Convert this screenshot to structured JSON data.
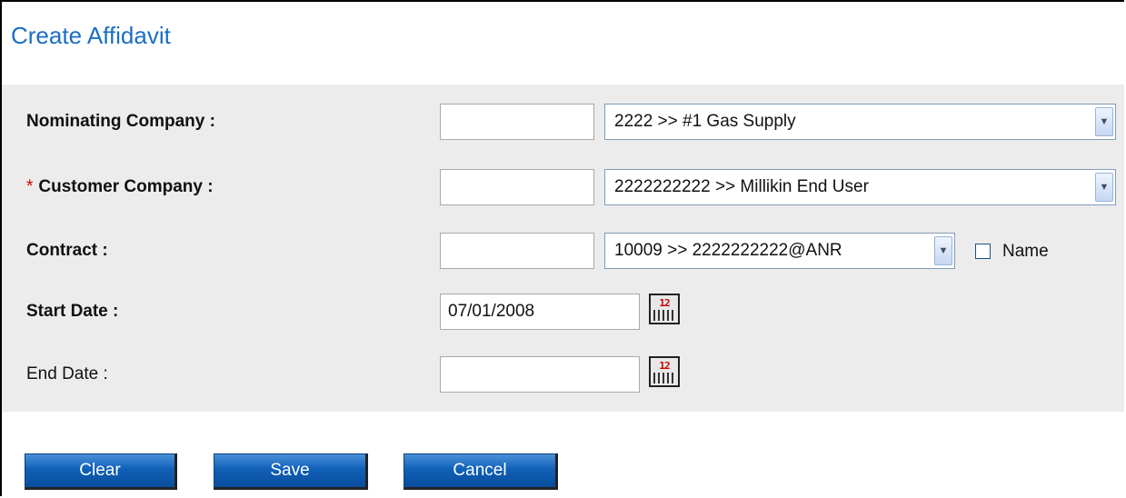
{
  "page": {
    "title": "Create Affidavit"
  },
  "form": {
    "nominating": {
      "label": "Nominating Company :",
      "code_value": "",
      "selected": "2222 >> #1 Gas Supply"
    },
    "customer": {
      "required_mark": "*",
      "label": "Customer Company :",
      "code_value": "",
      "selected": "2222222222 >> Millikin End User"
    },
    "contract": {
      "label": "Contract :",
      "code_value": "",
      "selected": "10009 >> 2222222222@ANR",
      "name_checkbox_label": "Name",
      "name_checked": false
    },
    "start_date": {
      "label": "Start Date :",
      "value": "07/01/2008"
    },
    "end_date": {
      "label": "End Date :",
      "value": ""
    }
  },
  "buttons": {
    "clear": "Clear",
    "save": "Save",
    "cancel": "Cancel"
  },
  "icons": {
    "dropdown": "chevron-down-icon",
    "calendar": "calendar-icon"
  },
  "colors": {
    "title": "#1a6fc4",
    "button": "#1060b8",
    "panel": "#ececec",
    "required": "#dd0000"
  }
}
